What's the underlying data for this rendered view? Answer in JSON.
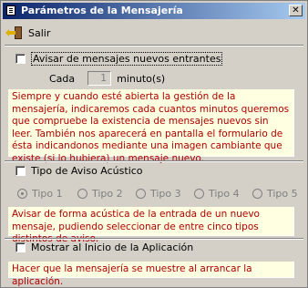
{
  "window": {
    "title": "Parámetros de la Mensajería",
    "close_label": "✕"
  },
  "toolbar": {
    "exit_label": "Salir"
  },
  "notify": {
    "checkbox_label": "Avisar de mensajes nuevos entrantes",
    "checked": false,
    "every_label": "Cada",
    "interval_value": "1",
    "interval_unit": "minuto(s)",
    "description": "Siempre y cuando esté abierta la gestión de la mensajería, indicaremos cada cuantos minutos queremos que compruebe la existencia de mensajes nuevos sin leer. También nos aparecerá en pantalla el formulario de ésta indicandonos mediante una imagen cambiante que existe (si lo hubiera) un mensaje nuevo."
  },
  "sound": {
    "checkbox_label": "Tipo de Aviso Acústico",
    "checked": false,
    "options": [
      "Tipo 1",
      "Tipo 2",
      "Tipo 3",
      "Tipo 4",
      "Tipo 5"
    ],
    "selected": "Tipo 1",
    "description": "Avisar de forma acústica de la entrada de un nuevo mensaje, pudiendo seleccionar de entre cinco tipos distintos de aviso."
  },
  "startup": {
    "checkbox_label": "Mostrar al Inicio de la Aplicación",
    "checked": false,
    "description": "Hacer que la mensajería se muestre al arrancar la aplicación."
  },
  "colors": {
    "title_start": "#0a246a",
    "title_end": "#a6caf0",
    "info_bg": "#ffffe1",
    "info_text": "#b00000"
  }
}
